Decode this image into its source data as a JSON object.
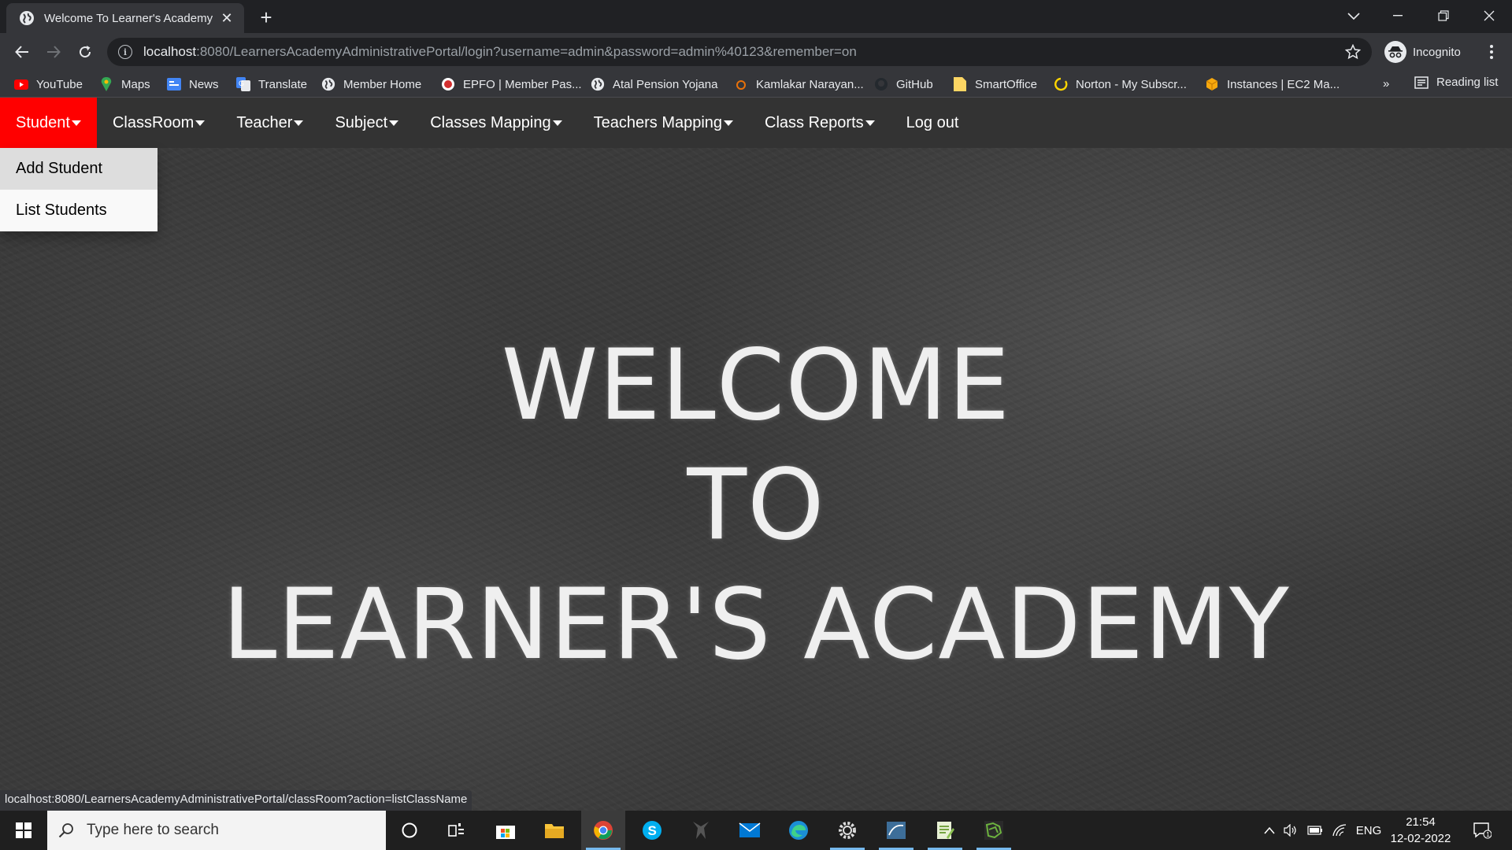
{
  "browser": {
    "tab_title": "Welcome To Learner's Academy",
    "new_tab_symbol": "+",
    "close_symbol": "✕",
    "url_host": "localhost",
    "url_rest": ":8080/LearnersAcademyAdministrativePortal/login?username=admin&password=admin%40123&remember=on",
    "profile_label": "Incognito",
    "bookmarks": [
      {
        "label": "YouTube",
        "icon": "youtube-icon"
      },
      {
        "label": "Maps",
        "icon": "maps-icon"
      },
      {
        "label": "News",
        "icon": "news-icon"
      },
      {
        "label": "Translate",
        "icon": "translate-icon"
      },
      {
        "label": "Member Home",
        "icon": "globe-icon"
      },
      {
        "label": "EPFO | Member Pas...",
        "icon": "epfo-icon"
      },
      {
        "label": "Atal Pension Yojana",
        "icon": "globe-icon"
      },
      {
        "label": "Kamlakar Narayan...",
        "icon": "ring-icon"
      },
      {
        "label": "GitHub",
        "icon": "github-icon"
      },
      {
        "label": "SmartOffice",
        "icon": "folder-icon"
      },
      {
        "label": "Norton - My Subscr...",
        "icon": "norton-icon"
      },
      {
        "label": "Instances | EC2 Ma...",
        "icon": "aws-icon"
      }
    ],
    "bookmarks_overflow": "»",
    "reading_list": "Reading list"
  },
  "app": {
    "nav": [
      {
        "label": "Student",
        "dropdown": true,
        "active": true
      },
      {
        "label": "ClassRoom",
        "dropdown": true
      },
      {
        "label": "Teacher",
        "dropdown": true
      },
      {
        "label": "Subject",
        "dropdown": true
      },
      {
        "label": "Classes Mapping",
        "dropdown": true
      },
      {
        "label": "Teachers Mapping",
        "dropdown": true
      },
      {
        "label": "Class Reports",
        "dropdown": true
      },
      {
        "label": "Log out",
        "dropdown": false
      }
    ],
    "student_menu": [
      "Add Student",
      "List Students"
    ],
    "welcome_lines": [
      "WELCOME",
      "TO",
      "LEARNER'S ACADEMY"
    ],
    "active_color": "#ff0000",
    "nav_bg": "#333333"
  },
  "status_bar_url": "localhost:8080/LearnersAcademyAdministrativePortal/classRoom?action=listClassName",
  "taskbar": {
    "search_placeholder": "Type here to search",
    "apps": [
      "cortana-icon",
      "task-view-icon",
      "store-icon",
      "file-explorer-icon",
      "chrome-icon",
      "skype-icon",
      "predator-icon",
      "mail-icon",
      "edge-icon",
      "settings-icon",
      "mysql-workbench-icon",
      "notepad-icon",
      "spring-tool-suite-icon"
    ],
    "language": "ENG",
    "time": "21:54",
    "date": "12-02-2022",
    "notification_count": "1"
  }
}
